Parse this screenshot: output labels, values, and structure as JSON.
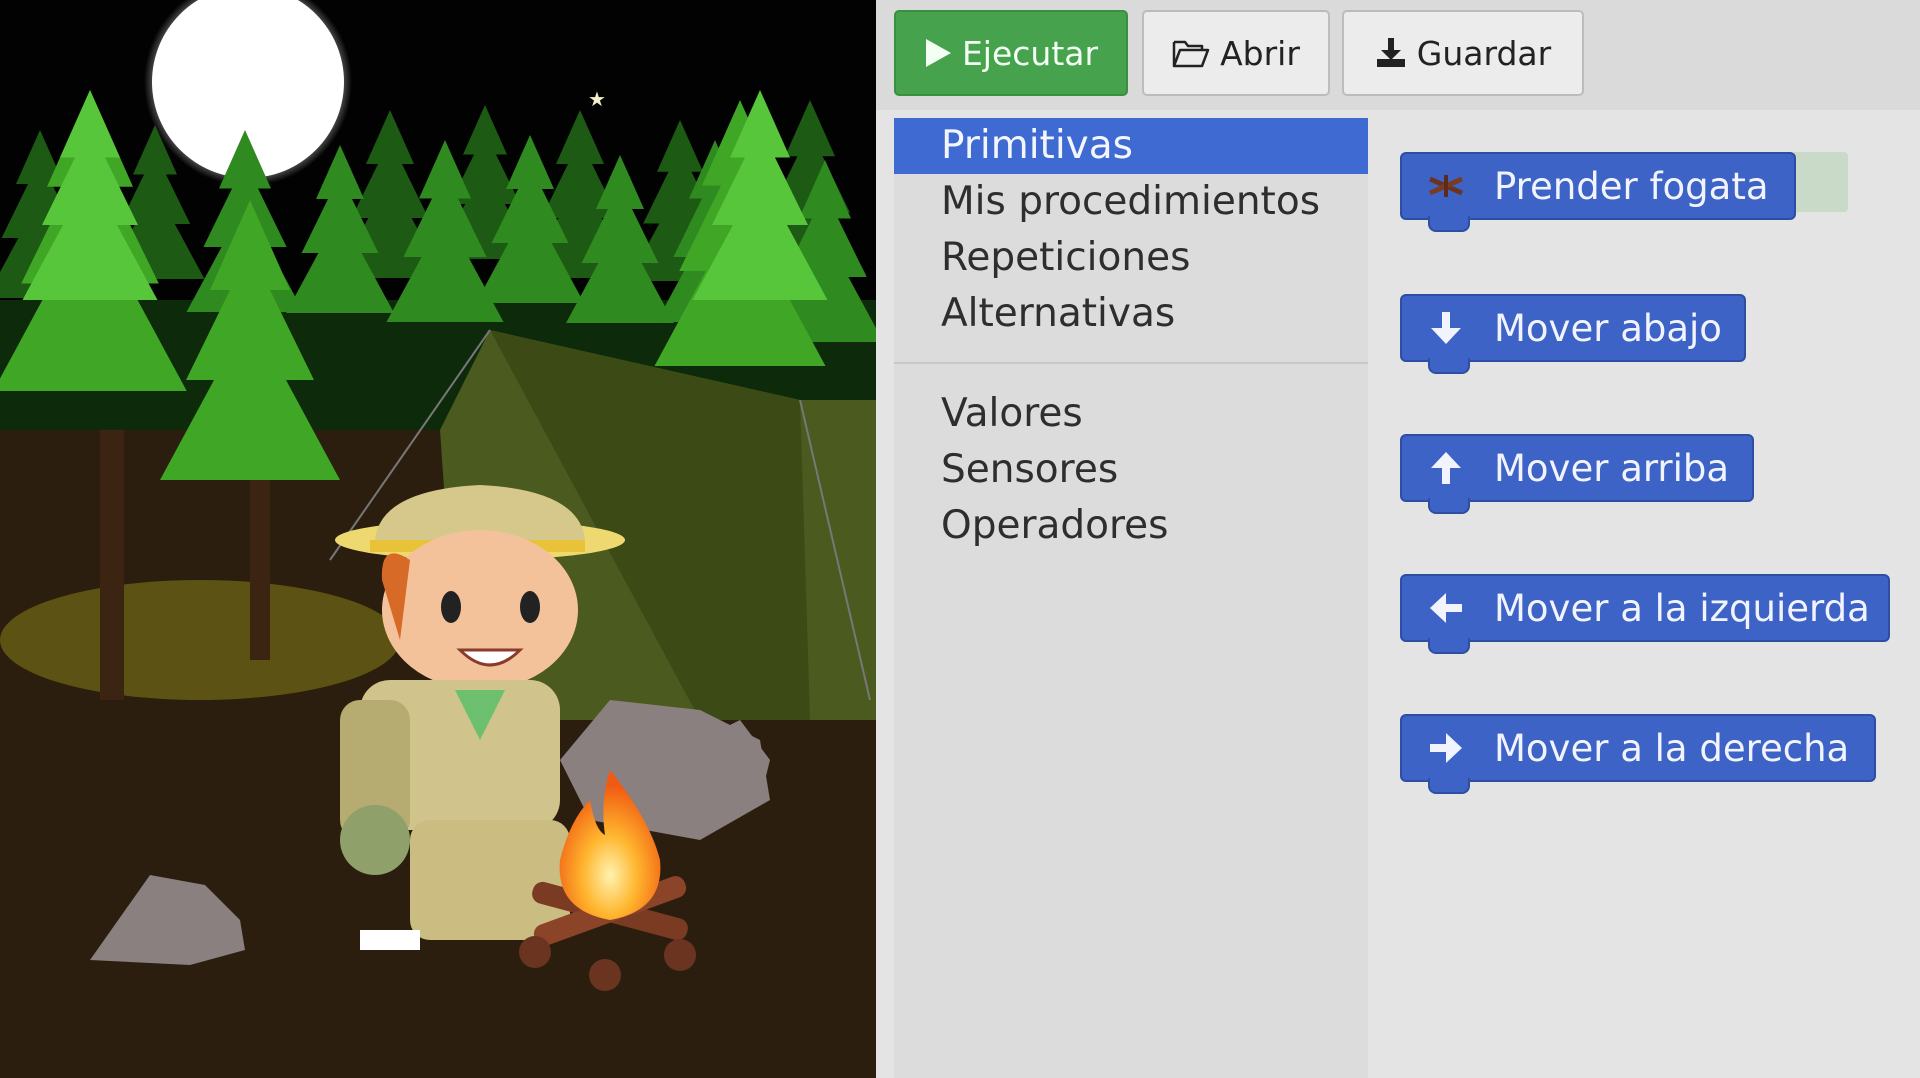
{
  "toolbar": {
    "run_label": "Ejecutar",
    "open_label": "Abrir",
    "save_label": "Guardar"
  },
  "categories": {
    "primary": [
      "Primitivas",
      "Mis procedimientos",
      "Repeticiones",
      "Alternativas"
    ],
    "secondary": [
      "Valores",
      "Sensores",
      "Operadores"
    ],
    "selected": "Primitivas"
  },
  "blocks": [
    {
      "label": "Prender fogata",
      "icon": "fire-sticks-icon"
    },
    {
      "label": "Mover abajo",
      "icon": "arrow-down-icon"
    },
    {
      "label": "Mover arriba",
      "icon": "arrow-up-icon"
    },
    {
      "label": "Mover a la izquierda",
      "icon": "arrow-left-icon"
    },
    {
      "label": "Mover a la derecha",
      "icon": "arrow-right-icon"
    }
  ],
  "colors": {
    "run_button": "#46a24c",
    "selected_category": "#3f6ad1",
    "block": "#3e63c6",
    "forest": "#3fa626",
    "moon": "#ffffff"
  }
}
